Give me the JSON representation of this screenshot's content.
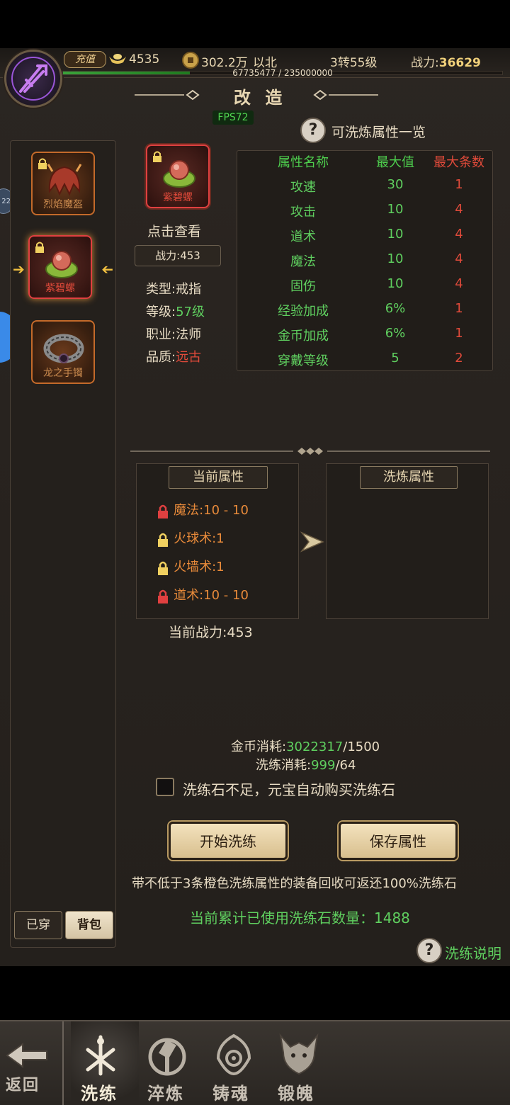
{
  "header": {
    "recharge_label": "充值",
    "ingot_count": "4535",
    "gold_amount": "302.2万",
    "server_name": "以北",
    "level": "3转55级",
    "power_label": "战力:",
    "power_value": "36629",
    "exp_text": "67735477 / 235000000",
    "exp_progress": 0.288
  },
  "title": "改 造",
  "fps": "FPS72",
  "attr_overview_label": "可洗炼属性一览",
  "equipment_list": [
    {
      "name": "烈焰魔盔",
      "locked": true
    },
    {
      "name": "紫碧螺",
      "locked": true,
      "selected": true
    },
    {
      "name": "龙之手镯",
      "locked": false
    }
  ],
  "current_item": {
    "name": "紫碧螺",
    "view_label": "点击查看",
    "power": "战力:453",
    "type_label": "类型:",
    "type_value": "戒指",
    "level_label": "等级:",
    "level_value": "57级",
    "class_label": "职业:",
    "class_value": "法师",
    "quality_label": "品质:",
    "quality_value": "远古"
  },
  "attr_table": {
    "headers": [
      "属性名称",
      "最大值",
      "最大条数"
    ],
    "rows": [
      [
        "攻速",
        "30",
        "1"
      ],
      [
        "攻击",
        "10",
        "4"
      ],
      [
        "道术",
        "10",
        "4"
      ],
      [
        "魔法",
        "10",
        "4"
      ],
      [
        "固伤",
        "10",
        "4"
      ],
      [
        "经验加成",
        "6%",
        "1"
      ],
      [
        "金币加成",
        "6%",
        "1"
      ],
      [
        "穿戴等级",
        "5",
        "2"
      ]
    ]
  },
  "current_props": {
    "title": "当前属性",
    "lines": [
      {
        "text": "魔法:10 - 10",
        "lock": "red"
      },
      {
        "text": "火球术:1",
        "lock": "gold"
      },
      {
        "text": "火墙术:1",
        "lock": "gold"
      },
      {
        "text": "道术:10 - 10",
        "lock": "red"
      }
    ],
    "power_text": "当前战力:453"
  },
  "refine_props": {
    "title": "洗炼属性"
  },
  "cost": {
    "gold_label": "金币消耗:",
    "gold_have": "3022317",
    "gold_need": "/1500",
    "stone_label": "洗练消耗:",
    "stone_have": "999",
    "stone_need": "/64"
  },
  "auto_buy_label": "洗练石不足，元宝自动购买洗练石",
  "start_button": "开始洗练",
  "save_button": "保存属性",
  "note_text": "带不低于3条橙色洗练属性的装备回收可返还100%洗练石",
  "used_text": "当前累计已使用洗练石数量：1488",
  "help_label": "洗练说明",
  "tabs": {
    "worn": "已穿",
    "bag": "背包"
  },
  "side_badge": "22",
  "nav": {
    "back": "返回",
    "items": [
      "洗练",
      "淬炼",
      "铸魂",
      "锻魄"
    ]
  }
}
